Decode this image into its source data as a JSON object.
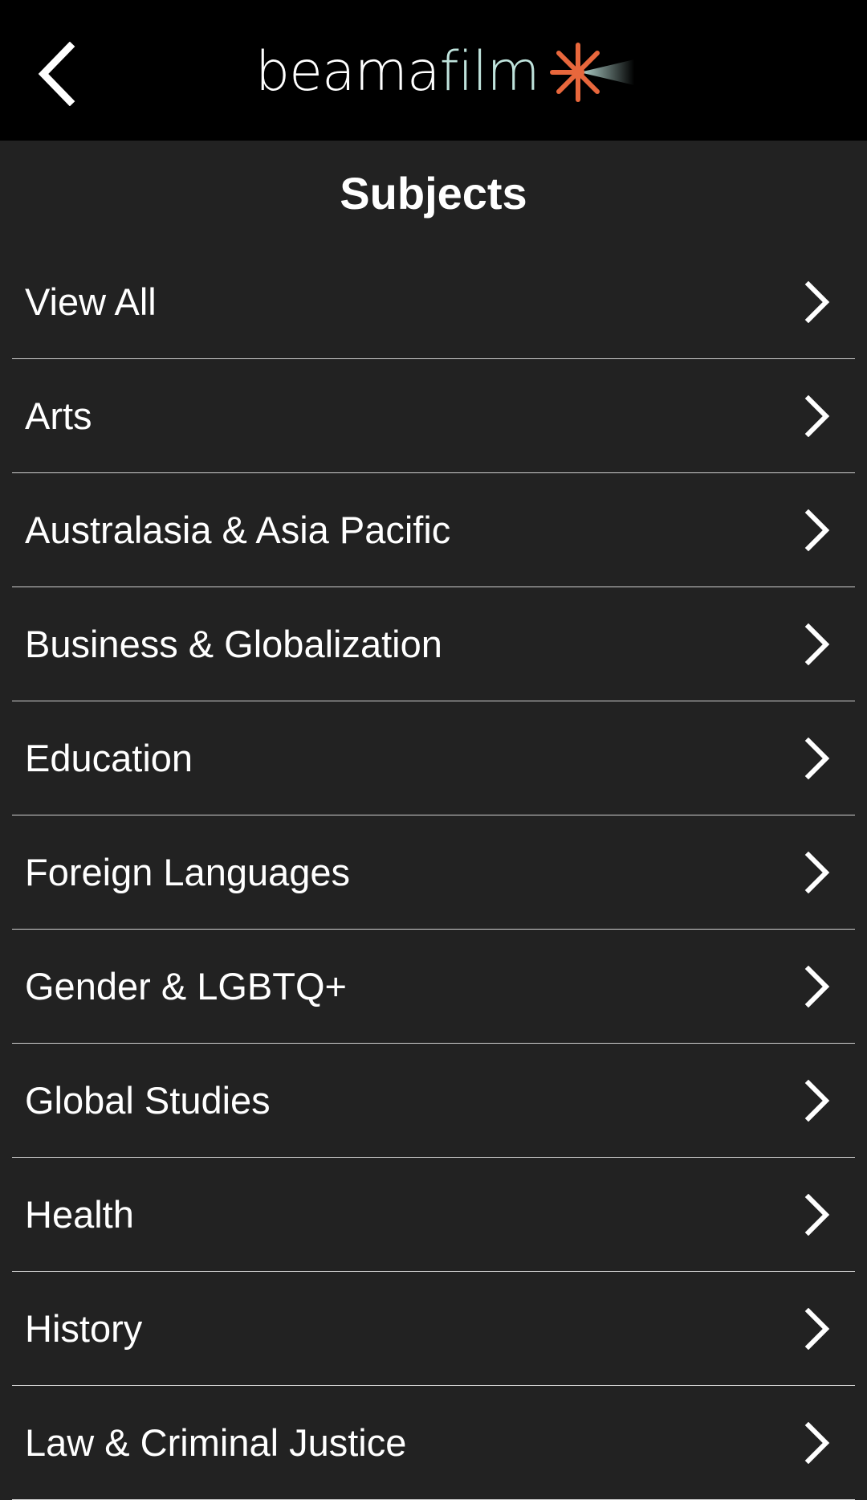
{
  "header": {
    "logo_beam": "beama",
    "logo_film": "film",
    "back_icon": "chevron-left-icon",
    "logo_icon": "starburst-icon",
    "background": "#000000",
    "logo_accent": "#e8673c",
    "logo_film_color": "#bfe3dc"
  },
  "page": {
    "title": "Subjects",
    "background": "#222222"
  },
  "subjects": [
    {
      "label": "View All"
    },
    {
      "label": "Arts"
    },
    {
      "label": "Australasia & Asia Pacific"
    },
    {
      "label": "Business & Globalization"
    },
    {
      "label": "Education"
    },
    {
      "label": "Foreign Languages"
    },
    {
      "label": "Gender & LGBTQ+"
    },
    {
      "label": "Global Studies"
    },
    {
      "label": "Health"
    },
    {
      "label": "History"
    },
    {
      "label": "Law & Criminal Justice"
    }
  ],
  "row_icon": "chevron-right-icon"
}
